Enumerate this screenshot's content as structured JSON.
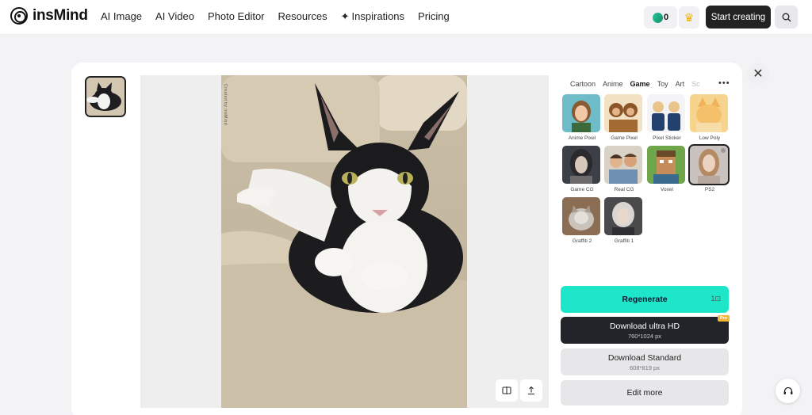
{
  "brand": {
    "name": "insMind"
  },
  "nav": {
    "items": [
      "AI Image",
      "AI Video",
      "Photo Editor",
      "Resources",
      "Inspirations",
      "Pricing"
    ]
  },
  "header": {
    "credits": "0",
    "start_label": "Start creating"
  },
  "preview": {
    "watermark": "Created by insMind"
  },
  "style_panel": {
    "tabs": [
      "Cartoon",
      "Anime",
      "Game",
      "Toy",
      "Art",
      "Sc"
    ],
    "active_tab": "Game",
    "styles": [
      {
        "label": "Anime Pixel"
      },
      {
        "label": "Game Pixel"
      },
      {
        "label": "Pixel Sticker"
      },
      {
        "label": "Low Poly"
      },
      {
        "label": "Game CG"
      },
      {
        "label": "Real CG"
      },
      {
        "label": "Voxel"
      },
      {
        "label": "PS2"
      },
      {
        "label": "Graffiti 2"
      },
      {
        "label": "Graffiti 1"
      }
    ],
    "selected_style": "PS2"
  },
  "actions": {
    "regenerate": {
      "label": "Regenerate",
      "cost": "1"
    },
    "download_hd": {
      "label": "Download ultra HD",
      "size": "760*1024 px",
      "badge": "Pro"
    },
    "download_standard": {
      "label": "Download Standard",
      "size": "608*819 px"
    },
    "edit_more": {
      "label": "Edit more"
    }
  },
  "colors": {
    "accent": "#1de6c9",
    "dark": "#22242a",
    "pro_badge": "#f5b52f"
  }
}
